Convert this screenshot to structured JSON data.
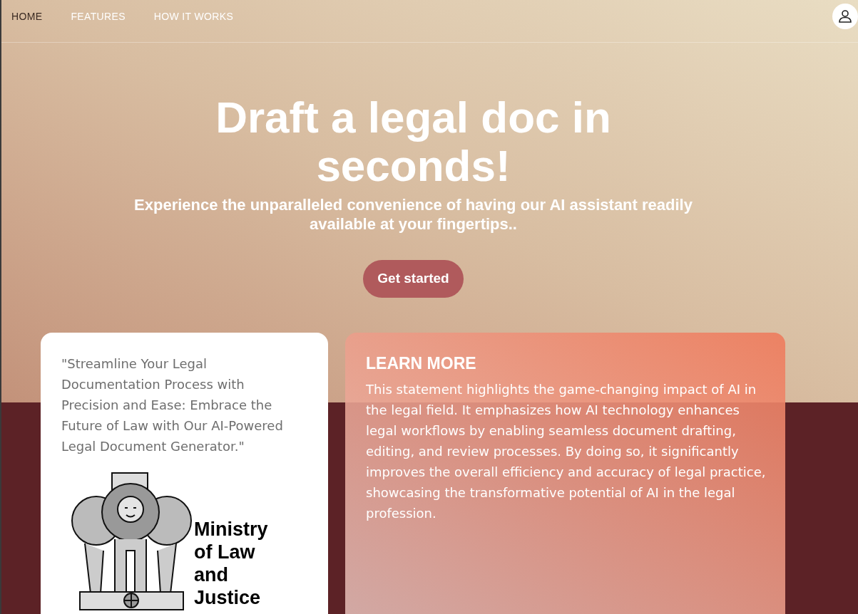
{
  "nav": {
    "links": [
      {
        "label": "HOME",
        "selected": true
      },
      {
        "label": "FEATURES",
        "selected": false
      },
      {
        "label": "HOW IT WORKS",
        "selected": false
      }
    ]
  },
  "hero": {
    "title": "Draft a legal doc in seconds!",
    "subtitle": "Experience the unparalleled convenience of having our AI assistant readily available at your fingertips..",
    "button": "Get started"
  },
  "quote_card": {
    "quote": "\"Streamline Your Legal Documentation Process with Precision and Ease: Embrace the Future of Law with Our AI-Powered Legal Document Generator.\"",
    "logo_text": "Ministry of Law and Justice"
  },
  "learn_more_card": {
    "title": "LEARN MORE",
    "body": "This statement highlights the game-changing impact of AI in the legal field. It emphasizes how AI technology enhances legal workflows by enabling seamless document drafting, editing, and review processes. By doing so, it significantly improves the overall efficiency and accuracy of legal practice, showcasing the transformative potential of AI in the legal profession."
  }
}
